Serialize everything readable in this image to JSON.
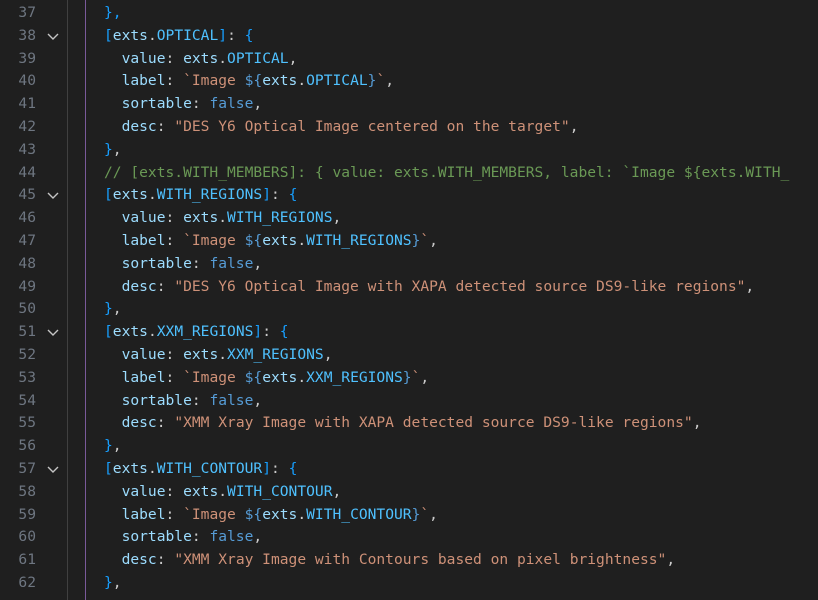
{
  "editor": {
    "colors": {
      "background": "#1f1f1f",
      "line_number": "#6e7681",
      "string": "#ce9178",
      "keyword": "#569cd6",
      "property": "#9cdcfe",
      "constant": "#4fc1ff",
      "comment": "#6a9955",
      "bracket_1": "#da70d6",
      "bracket_2": "#179fff",
      "bracket_3": "#ffd700"
    },
    "lines": [
      {
        "num": "37",
        "fold": false,
        "tokens": [
          [
            "t-br2",
            "},"
          ]
        ]
      },
      {
        "num": "38",
        "fold": true,
        "tokens": [
          [
            "t-br2",
            "["
          ],
          [
            "t-var",
            "exts"
          ],
          [
            "t-punc",
            "."
          ],
          [
            "t-const",
            "OPTICAL"
          ],
          [
            "t-br2",
            "]"
          ],
          [
            "t-punc",
            ": "
          ],
          [
            "t-br2",
            "{"
          ]
        ]
      },
      {
        "num": "39",
        "fold": false,
        "tokens": [
          [
            "t-punc",
            "  "
          ],
          [
            "t-prop",
            "value"
          ],
          [
            "t-punc",
            ": "
          ],
          [
            "t-var",
            "exts"
          ],
          [
            "t-punc",
            "."
          ],
          [
            "t-const",
            "OPTICAL"
          ],
          [
            "t-punc",
            ","
          ]
        ]
      },
      {
        "num": "40",
        "fold": false,
        "tokens": [
          [
            "t-punc",
            "  "
          ],
          [
            "t-prop",
            "label"
          ],
          [
            "t-punc",
            ": "
          ],
          [
            "t-str",
            "`Image "
          ],
          [
            "t-kw",
            "${"
          ],
          [
            "t-var",
            "exts"
          ],
          [
            "t-punc",
            "."
          ],
          [
            "t-const",
            "OPTICAL"
          ],
          [
            "t-kw",
            "}"
          ],
          [
            "t-str",
            "`"
          ],
          [
            "t-punc",
            ","
          ]
        ]
      },
      {
        "num": "41",
        "fold": false,
        "tokens": [
          [
            "t-punc",
            "  "
          ],
          [
            "t-prop",
            "sortable"
          ],
          [
            "t-punc",
            ": "
          ],
          [
            "t-kw",
            "false"
          ],
          [
            "t-punc",
            ","
          ]
        ]
      },
      {
        "num": "42",
        "fold": false,
        "tokens": [
          [
            "t-punc",
            "  "
          ],
          [
            "t-prop",
            "desc"
          ],
          [
            "t-punc",
            ": "
          ],
          [
            "t-str",
            "\"DES Y6 Optical Image centered on the target\""
          ],
          [
            "t-punc",
            ","
          ]
        ]
      },
      {
        "num": "43",
        "fold": false,
        "tokens": [
          [
            "t-br2",
            "}"
          ],
          [
            "t-punc",
            ","
          ]
        ]
      },
      {
        "num": "44",
        "fold": false,
        "tokens": [
          [
            "t-cmt",
            "// [exts.WITH_MEMBERS]: { value: exts.WITH_MEMBERS, label: `Image ${exts.WITH_"
          ]
        ]
      },
      {
        "num": "45",
        "fold": true,
        "tokens": [
          [
            "t-br2",
            "["
          ],
          [
            "t-var",
            "exts"
          ],
          [
            "t-punc",
            "."
          ],
          [
            "t-const",
            "WITH_REGIONS"
          ],
          [
            "t-br2",
            "]"
          ],
          [
            "t-punc",
            ": "
          ],
          [
            "t-br2",
            "{"
          ]
        ]
      },
      {
        "num": "46",
        "fold": false,
        "tokens": [
          [
            "t-punc",
            "  "
          ],
          [
            "t-prop",
            "value"
          ],
          [
            "t-punc",
            ": "
          ],
          [
            "t-var",
            "exts"
          ],
          [
            "t-punc",
            "."
          ],
          [
            "t-const",
            "WITH_REGIONS"
          ],
          [
            "t-punc",
            ","
          ]
        ]
      },
      {
        "num": "47",
        "fold": false,
        "tokens": [
          [
            "t-punc",
            "  "
          ],
          [
            "t-prop",
            "label"
          ],
          [
            "t-punc",
            ": "
          ],
          [
            "t-str",
            "`Image "
          ],
          [
            "t-kw",
            "${"
          ],
          [
            "t-var",
            "exts"
          ],
          [
            "t-punc",
            "."
          ],
          [
            "t-const",
            "WITH_REGIONS"
          ],
          [
            "t-kw",
            "}"
          ],
          [
            "t-str",
            "`"
          ],
          [
            "t-punc",
            ","
          ]
        ]
      },
      {
        "num": "48",
        "fold": false,
        "tokens": [
          [
            "t-punc",
            "  "
          ],
          [
            "t-prop",
            "sortable"
          ],
          [
            "t-punc",
            ": "
          ],
          [
            "t-kw",
            "false"
          ],
          [
            "t-punc",
            ","
          ]
        ]
      },
      {
        "num": "49",
        "fold": false,
        "tokens": [
          [
            "t-punc",
            "  "
          ],
          [
            "t-prop",
            "desc"
          ],
          [
            "t-punc",
            ": "
          ],
          [
            "t-str",
            "\"DES Y6 Optical Image with XAPA detected source DS9-like regions\""
          ],
          [
            "t-punc",
            ","
          ]
        ]
      },
      {
        "num": "50",
        "fold": false,
        "tokens": [
          [
            "t-br2",
            "}"
          ],
          [
            "t-punc",
            ","
          ]
        ]
      },
      {
        "num": "51",
        "fold": true,
        "tokens": [
          [
            "t-br2",
            "["
          ],
          [
            "t-var",
            "exts"
          ],
          [
            "t-punc",
            "."
          ],
          [
            "t-const",
            "XXM_REGIONS"
          ],
          [
            "t-br2",
            "]"
          ],
          [
            "t-punc",
            ": "
          ],
          [
            "t-br2",
            "{"
          ]
        ]
      },
      {
        "num": "52",
        "fold": false,
        "tokens": [
          [
            "t-punc",
            "  "
          ],
          [
            "t-prop",
            "value"
          ],
          [
            "t-punc",
            ": "
          ],
          [
            "t-var",
            "exts"
          ],
          [
            "t-punc",
            "."
          ],
          [
            "t-const",
            "XXM_REGIONS"
          ],
          [
            "t-punc",
            ","
          ]
        ]
      },
      {
        "num": "53",
        "fold": false,
        "tokens": [
          [
            "t-punc",
            "  "
          ],
          [
            "t-prop",
            "label"
          ],
          [
            "t-punc",
            ": "
          ],
          [
            "t-str",
            "`Image "
          ],
          [
            "t-kw",
            "${"
          ],
          [
            "t-var",
            "exts"
          ],
          [
            "t-punc",
            "."
          ],
          [
            "t-const",
            "XXM_REGIONS"
          ],
          [
            "t-kw",
            "}"
          ],
          [
            "t-str",
            "`"
          ],
          [
            "t-punc",
            ","
          ]
        ]
      },
      {
        "num": "54",
        "fold": false,
        "tokens": [
          [
            "t-punc",
            "  "
          ],
          [
            "t-prop",
            "sortable"
          ],
          [
            "t-punc",
            ": "
          ],
          [
            "t-kw",
            "false"
          ],
          [
            "t-punc",
            ","
          ]
        ]
      },
      {
        "num": "55",
        "fold": false,
        "tokens": [
          [
            "t-punc",
            "  "
          ],
          [
            "t-prop",
            "desc"
          ],
          [
            "t-punc",
            ": "
          ],
          [
            "t-str",
            "\"XMM Xray Image with XAPA detected source DS9-like regions\""
          ],
          [
            "t-punc",
            ","
          ]
        ]
      },
      {
        "num": "56",
        "fold": false,
        "tokens": [
          [
            "t-br2",
            "}"
          ],
          [
            "t-punc",
            ","
          ]
        ]
      },
      {
        "num": "57",
        "fold": true,
        "tokens": [
          [
            "t-br2",
            "["
          ],
          [
            "t-var",
            "exts"
          ],
          [
            "t-punc",
            "."
          ],
          [
            "t-const",
            "WITH_CONTOUR"
          ],
          [
            "t-br2",
            "]"
          ],
          [
            "t-punc",
            ": "
          ],
          [
            "t-br2",
            "{"
          ]
        ]
      },
      {
        "num": "58",
        "fold": false,
        "tokens": [
          [
            "t-punc",
            "  "
          ],
          [
            "t-prop",
            "value"
          ],
          [
            "t-punc",
            ": "
          ],
          [
            "t-var",
            "exts"
          ],
          [
            "t-punc",
            "."
          ],
          [
            "t-const",
            "WITH_CONTOUR"
          ],
          [
            "t-punc",
            ","
          ]
        ]
      },
      {
        "num": "59",
        "fold": false,
        "tokens": [
          [
            "t-punc",
            "  "
          ],
          [
            "t-prop",
            "label"
          ],
          [
            "t-punc",
            ": "
          ],
          [
            "t-str",
            "`Image "
          ],
          [
            "t-kw",
            "${"
          ],
          [
            "t-var",
            "exts"
          ],
          [
            "t-punc",
            "."
          ],
          [
            "t-const",
            "WITH_CONTOUR"
          ],
          [
            "t-kw",
            "}"
          ],
          [
            "t-str",
            "`"
          ],
          [
            "t-punc",
            ","
          ]
        ]
      },
      {
        "num": "60",
        "fold": false,
        "tokens": [
          [
            "t-punc",
            "  "
          ],
          [
            "t-prop",
            "sortable"
          ],
          [
            "t-punc",
            ": "
          ],
          [
            "t-kw",
            "false"
          ],
          [
            "t-punc",
            ","
          ]
        ]
      },
      {
        "num": "61",
        "fold": false,
        "tokens": [
          [
            "t-punc",
            "  "
          ],
          [
            "t-prop",
            "desc"
          ],
          [
            "t-punc",
            ": "
          ],
          [
            "t-str",
            "\"XMM Xray Image with Contours based on pixel brightness\""
          ],
          [
            "t-punc",
            ","
          ]
        ]
      },
      {
        "num": "62",
        "fold": false,
        "tokens": [
          [
            "t-br2",
            "}"
          ],
          [
            "t-punc",
            ","
          ]
        ]
      }
    ]
  }
}
